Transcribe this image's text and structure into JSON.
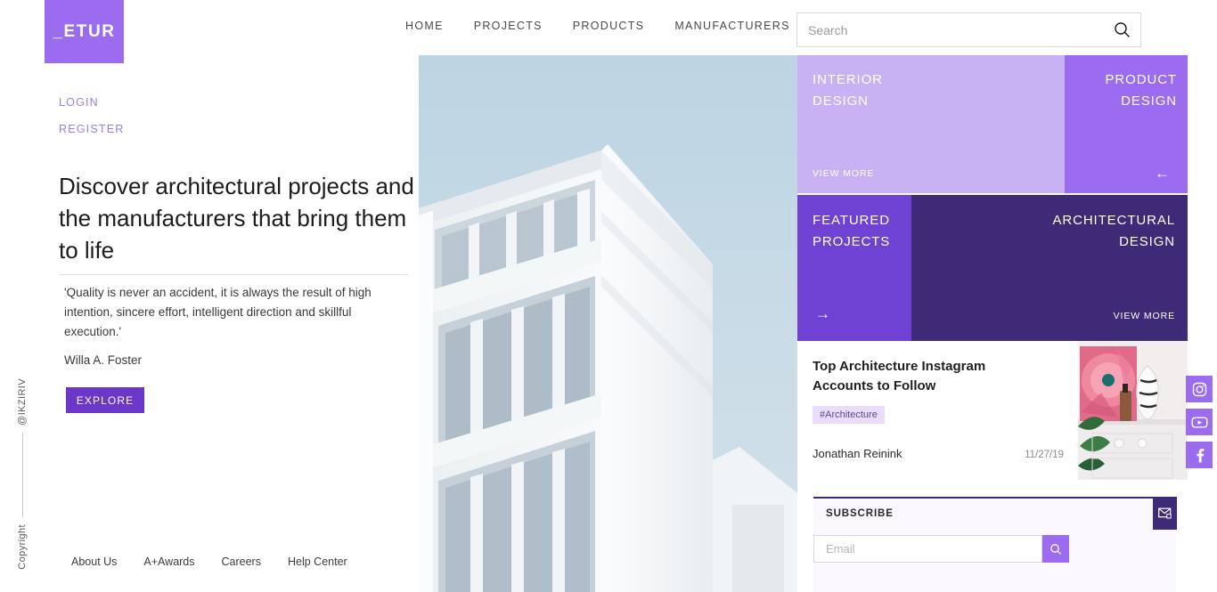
{
  "brand": {
    "logo_text": "_ETUR"
  },
  "nav": {
    "items": [
      {
        "label": "HOME"
      },
      {
        "label": "PROJECTS"
      },
      {
        "label": "PRODUCTS"
      },
      {
        "label": "MANUFACTURERS"
      }
    ]
  },
  "search": {
    "value": "",
    "placeholder": "Search",
    "icon": "search-icon"
  },
  "auth": {
    "login": "LOGIN",
    "register": "REGISTER"
  },
  "hero": {
    "headline": "Discover architectural projects and the manufacturers that bring them to life",
    "quote": "'Quality is never an accident, it is always the result of high intention, sincere effort, intelligent direction and skillful execution.'",
    "quote_author": "Willa A. Foster",
    "cta": "EXPLORE",
    "image_alt": "white modern building against pale blue sky"
  },
  "footer": {
    "links": [
      {
        "label": "About Us"
      },
      {
        "label": "A+Awards"
      },
      {
        "label": "Careers"
      },
      {
        "label": "Help Center"
      }
    ]
  },
  "rail": {
    "handle": "@IKZIRIV",
    "copyright": "Copyright"
  },
  "tiles": [
    {
      "title": "INTERIOR\nDESIGN",
      "action": "VIEW MORE",
      "arrow": "",
      "color": "#c9b2f4"
    },
    {
      "title": "PRODUCT\nDESIGN",
      "action": "",
      "arrow": "←",
      "color": "#9b6bf0"
    },
    {
      "title": "FEATURED\nPROJECTS",
      "action": "",
      "arrow": "→",
      "color": "#6f42d4"
    },
    {
      "title": "ARCHITECTURAL\nDESIGN",
      "action": "VIEW MORE",
      "arrow": "",
      "color": "#3e2a77"
    }
  ],
  "article": {
    "title": "Top Architecture Instagram Accounts to Follow",
    "tag": "#Architecture",
    "author": "Jonathan Reinink",
    "date": "11/27/19",
    "thumb_alt": "pink flower painting and vase on white dresser"
  },
  "subscribe": {
    "label": "SUBSCRIBE",
    "email_value": "",
    "email_placeholder": "Email",
    "submit_icon": "search-icon",
    "mail_icon": "mail-icon"
  },
  "social": [
    {
      "name": "instagram",
      "label": "Instagram"
    },
    {
      "name": "youtube",
      "label": "YouTube"
    },
    {
      "name": "facebook",
      "label": "Facebook"
    }
  ],
  "colors": {
    "brand_purple": "#9b6bf0",
    "deep_purple": "#6b37c9",
    "dark_purple": "#3e2a77",
    "light_lavender": "#c9b2f4",
    "tag_bg": "#eadcfb"
  }
}
